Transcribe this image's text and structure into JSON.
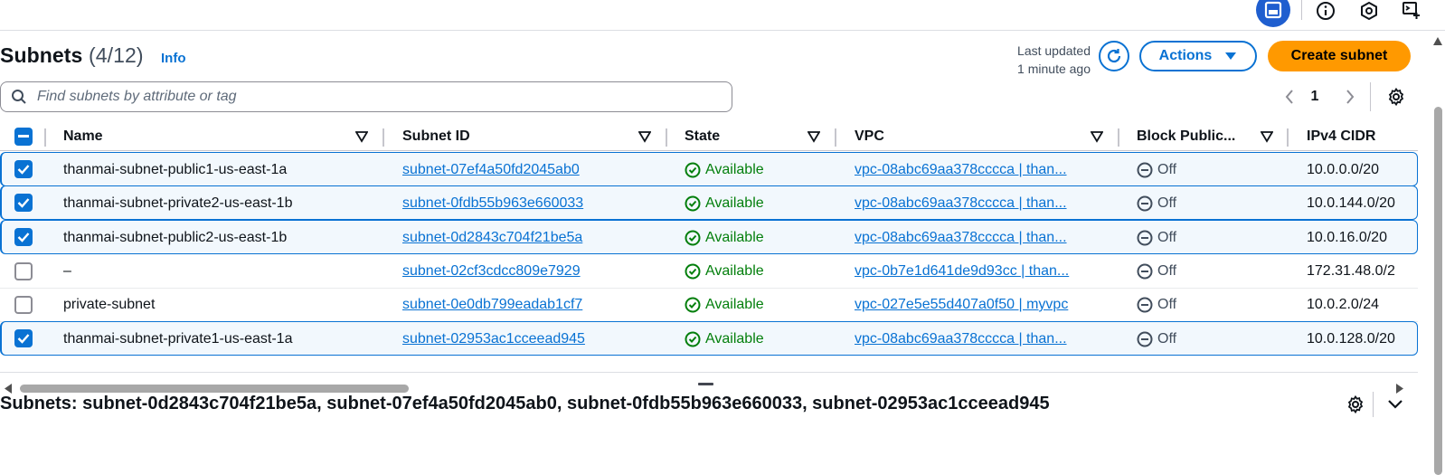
{
  "topbar": {
    "icons": [
      "panel-icon",
      "info-icon",
      "settings-hexagon-icon",
      "cloud-shell-icon"
    ]
  },
  "header": {
    "title": "Subnets",
    "count": "(4/12)",
    "info_label": "Info",
    "last_updated_label": "Last updated",
    "last_updated_value": "1 minute ago",
    "actions_label": "Actions",
    "create_label": "Create subnet"
  },
  "search": {
    "placeholder": "Find subnets by attribute or tag"
  },
  "pagination": {
    "current_page": "1"
  },
  "table": {
    "columns": [
      "Name",
      "Subnet ID",
      "State",
      "VPC",
      "Block Public...",
      "IPv4 CIDR"
    ],
    "rows": [
      {
        "selected": true,
        "name": "thanmai-subnet-public1-us-east-1a",
        "subnet_id": "subnet-07ef4a50fd2045ab0",
        "state": "Available",
        "vpc": "vpc-08abc69aa378cccca | than...",
        "block_public": "Off",
        "ipv4_cidr": "10.0.0.0/20"
      },
      {
        "selected": true,
        "name": "thanmai-subnet-private2-us-east-1b",
        "subnet_id": "subnet-0fdb55b963e660033",
        "state": "Available",
        "vpc": "vpc-08abc69aa378cccca | than...",
        "block_public": "Off",
        "ipv4_cidr": "10.0.144.0/20"
      },
      {
        "selected": true,
        "name": "thanmai-subnet-public2-us-east-1b",
        "subnet_id": "subnet-0d2843c704f21be5a",
        "state": "Available",
        "vpc": "vpc-08abc69aa378cccca | than...",
        "block_public": "Off",
        "ipv4_cidr": "10.0.16.0/20"
      },
      {
        "selected": false,
        "name": "–",
        "subnet_id": "subnet-02cf3cdcc809e7929",
        "state": "Available",
        "vpc": "vpc-0b7e1d641de9d93cc | than...",
        "block_public": "Off",
        "ipv4_cidr": "172.31.48.0/2"
      },
      {
        "selected": false,
        "name": "private-subnet",
        "subnet_id": "subnet-0e0db799eadab1cf7",
        "state": "Available",
        "vpc": "vpc-027e5e55d407a0f50 | myvpc",
        "block_public": "Off",
        "ipv4_cidr": "10.0.2.0/24"
      },
      {
        "selected": true,
        "name": "thanmai-subnet-private1-us-east-1a",
        "subnet_id": "subnet-02953ac1cceead945",
        "state": "Available",
        "vpc": "vpc-08abc69aa378cccca | than...",
        "block_public": "Off",
        "ipv4_cidr": "10.0.128.0/20"
      }
    ]
  },
  "details": {
    "title": "Subnets: subnet-0d2843c704f21be5a, subnet-07ef4a50fd2045ab0, subnet-0fdb55b963e660033, subnet-02953ac1cceead945"
  },
  "colors": {
    "link": "#0972d3",
    "primary": "#ff9900",
    "success": "#037f0c",
    "selected_bg": "#f2f8fd"
  }
}
